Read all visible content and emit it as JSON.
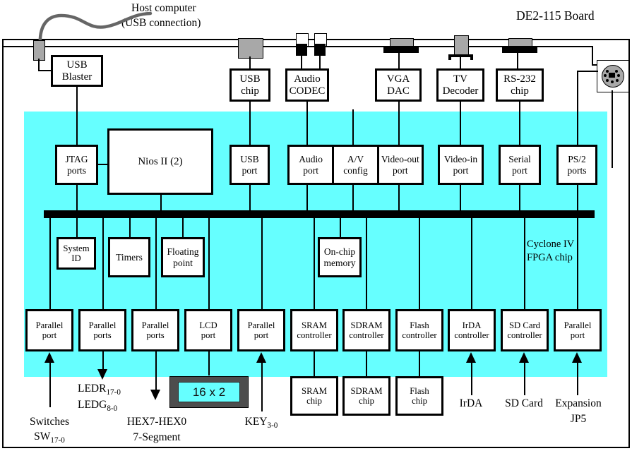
{
  "board": {
    "title": "DE2-115 Board",
    "fpga_label_line1": "Cyclone IV",
    "fpga_label_line2": "FPGA chip",
    "fpga_color": "#66ffff"
  },
  "host": {
    "line1": "Host computer",
    "line2": "(USB connection)"
  },
  "external_chips": [
    {
      "name": "usb-blaster",
      "l1": "USB",
      "l2": "Blaster"
    },
    {
      "name": "usb-chip",
      "l1": "USB",
      "l2": "chip"
    },
    {
      "name": "audio-codec",
      "l1": "Audio",
      "l2": "CODEC"
    },
    {
      "name": "vga-dac",
      "l1": "VGA",
      "l2": "DAC"
    },
    {
      "name": "tv-decoder",
      "l1": "TV",
      "l2": "Decoder"
    },
    {
      "name": "rs232-chip",
      "l1": "RS-232",
      "l2": "chip"
    }
  ],
  "connectors": [
    {
      "name": "usb-blaster-connector",
      "type": "gray-plug"
    },
    {
      "name": "usb-connector",
      "type": "gray-rect"
    },
    {
      "name": "audio-jack-left",
      "type": "audio-jack"
    },
    {
      "name": "audio-jack-right",
      "type": "audio-jack"
    },
    {
      "name": "vga-connector",
      "type": "dsub"
    },
    {
      "name": "tv-connector",
      "type": "rca-bracket"
    },
    {
      "name": "rs232-connector",
      "type": "dsub"
    },
    {
      "name": "ps2-connector",
      "type": "ps2-round"
    }
  ],
  "fpga_ports": [
    {
      "name": "jtag-ports",
      "l1": "JTAG",
      "l2": "ports"
    },
    {
      "name": "nios-ii",
      "l1": "Nios II (2)",
      "l2": ""
    },
    {
      "name": "usb-port",
      "l1": "USB",
      "l2": "port"
    },
    {
      "name": "audio-port",
      "l1": "Audio",
      "l2": "port"
    },
    {
      "name": "av-config",
      "l1": "A/V",
      "l2": "config"
    },
    {
      "name": "video-out-port",
      "l1": "Video-out",
      "l2": "port"
    },
    {
      "name": "video-in-port",
      "l1": "Video-in",
      "l2": "port"
    },
    {
      "name": "serial-port",
      "l1": "Serial",
      "l2": "port"
    },
    {
      "name": "ps2-ports",
      "l1": "PS/2",
      "l2": "ports"
    }
  ],
  "fpga_internal": [
    {
      "name": "system-id",
      "l1": "System",
      "l2": "ID"
    },
    {
      "name": "timers",
      "l1": "Timers",
      "l2": ""
    },
    {
      "name": "floating-point",
      "l1": "Floating",
      "l2": "point"
    },
    {
      "name": "on-chip-memory",
      "l1": "On-chip",
      "l2": "memory"
    }
  ],
  "fpga_controllers": [
    {
      "name": "parallel-port-switches",
      "l1": "Parallel",
      "l2": "port"
    },
    {
      "name": "parallel-ports-leds",
      "l1": "Parallel",
      "l2": "ports"
    },
    {
      "name": "parallel-ports-hex",
      "l1": "Parallel",
      "l2": "ports"
    },
    {
      "name": "lcd-port",
      "l1": "LCD",
      "l2": "port"
    },
    {
      "name": "parallel-port-keys",
      "l1": "Parallel",
      "l2": "port"
    },
    {
      "name": "sram-controller",
      "l1": "SRAM",
      "l2": "controller"
    },
    {
      "name": "sdram-controller",
      "l1": "SDRAM",
      "l2": "controller"
    },
    {
      "name": "flash-controller",
      "l1": "Flash",
      "l2": "controller"
    },
    {
      "name": "irda-controller",
      "l1": "IrDA",
      "l2": "controller"
    },
    {
      "name": "sdcard-controller",
      "l1": "SD Card",
      "l2": "controller"
    },
    {
      "name": "parallel-port-expansion",
      "l1": "Parallel",
      "l2": "port"
    }
  ],
  "memory_chips": [
    {
      "name": "sram-chip",
      "l1": "SRAM",
      "l2": "chip"
    },
    {
      "name": "sdram-chip",
      "l1": "SDRAM",
      "l2": "chip"
    },
    {
      "name": "flash-chip",
      "l1": "Flash",
      "l2": "chip"
    }
  ],
  "lcd": {
    "text": "16 x 2"
  },
  "bottom_labels": {
    "switches_l1": "Switches",
    "switches_l2_main": "SW",
    "switches_l2_sub": "17-0",
    "ledr_main": "LEDR",
    "ledr_sub": "17-0",
    "ledg_main": "LEDG",
    "ledg_sub": "8-0",
    "hex_l1": "HEX7-HEX0",
    "hex_l2": "7-Segment",
    "key_main": "KEY",
    "key_sub": "3-0",
    "irda": "IrDA",
    "sdcard": "SD Card",
    "expansion_l1": "Expansion",
    "expansion_l2": "JP5"
  }
}
